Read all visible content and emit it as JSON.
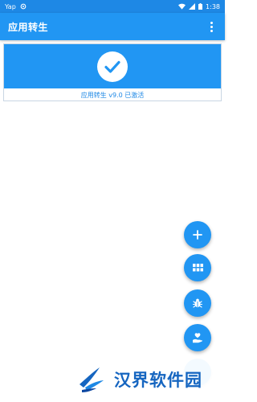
{
  "status_bar": {
    "left_text": "Yap",
    "time": "1:38"
  },
  "app_bar": {
    "title": "应用转生",
    "overflow_icon": "more-vert-icon"
  },
  "status_card": {
    "icon": "check-icon",
    "message": "应用转生 v9.0 已激活"
  },
  "fabs": [
    {
      "name": "add",
      "icon": "plus-icon"
    },
    {
      "name": "apps",
      "icon": "grid-icon"
    },
    {
      "name": "bug",
      "icon": "bug-icon"
    },
    {
      "name": "donate",
      "icon": "heart-hand-icon"
    },
    {
      "name": "partial",
      "icon": "unknown-icon"
    }
  ],
  "watermark": {
    "text": "汉界软件园"
  },
  "colors": {
    "primary": "#2196f3",
    "primary_dark": "#1e88e5",
    "background": "#ffffff"
  }
}
